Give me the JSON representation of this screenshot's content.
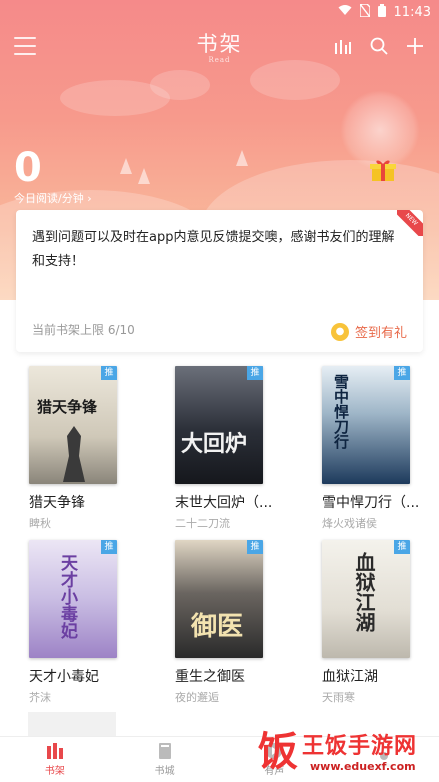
{
  "status_bar": {
    "time": "11:43",
    "icons": [
      "wifi-icon",
      "no-sim-icon",
      "battery-icon"
    ]
  },
  "header": {
    "title": "书架",
    "subtitle": "Read",
    "menu_icon": "list-menu-icon",
    "actions": [
      "bar-chart-icon",
      "search-icon",
      "plus-icon"
    ]
  },
  "reading": {
    "minutes": "0",
    "label": "今日阅读/分钟 ›"
  },
  "notice": {
    "message": "遇到问题可以及时在app内意见反馈提交噢，感谢书友们的理解和支持！",
    "badge": "NEW",
    "limit_text": "当前书架上限 6/10",
    "signin_label": "签到有礼"
  },
  "books": [
    {
      "name": "猎天争锋",
      "author": "睥秋",
      "tag": "推",
      "cover_text": "猎天争锋",
      "colors": [
        "#e9e3d6",
        "#8e8a80"
      ]
    },
    {
      "name": "末世大回炉（...",
      "author": "二十二刀流",
      "tag": "推",
      "cover_text": "大回炉",
      "colors": [
        "#2b2f38",
        "#8a8f99"
      ]
    },
    {
      "name": "雪中悍刀行（...",
      "author": "烽火戏诸侯",
      "tag": "推",
      "cover_text": "雪中悍刀行",
      "colors": [
        "#1d3a5c",
        "#dfe8ef"
      ]
    },
    {
      "name": "天才小毒妃",
      "author": "芥沫",
      "tag": "推",
      "cover_text": "天才小毒妃",
      "colors": [
        "#d9d4ec",
        "#7b5aa6"
      ]
    },
    {
      "name": "重生之御医",
      "author": "夜的邂逅",
      "tag": "推",
      "cover_text": "御医",
      "colors": [
        "#3a3a3a",
        "#c9a56a"
      ]
    },
    {
      "name": "血狱江湖",
      "author": "天雨寒",
      "tag": "推",
      "cover_text": "血狱江湖",
      "colors": [
        "#f2f0ea",
        "#555555"
      ]
    }
  ],
  "bottom_nav": [
    {
      "label": "书架",
      "icon": "bookshelf-icon",
      "active": true
    },
    {
      "label": "书城",
      "icon": "book-icon",
      "active": false
    },
    {
      "label": "有声",
      "icon": "play-icon",
      "active": false
    },
    {
      "label": "",
      "icon": "user-icon",
      "active": false
    }
  ],
  "watermark": {
    "logo": "饭",
    "title": "王饭手游网",
    "url": "www.eduexf.com"
  },
  "colors": {
    "accent": "#e8484b",
    "hero_top": "#f58a8a",
    "hero_bottom": "#fbd0b2",
    "tag_blue": "#4aa6e6",
    "signin": "#e86a4a"
  }
}
